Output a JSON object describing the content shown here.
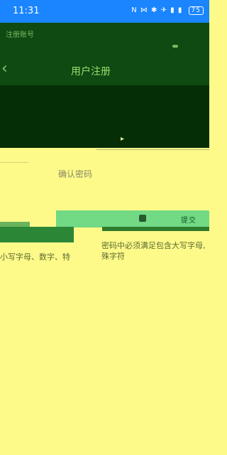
{
  "status": {
    "time": "11:31",
    "icons": "N ⋈ ✱ ✈ ▮ ▮",
    "battery": "75"
  },
  "header": {
    "title": "用户注册",
    "back_label": "‹",
    "sub": "注册账号"
  },
  "form": {
    "confirm_label": "确认密码",
    "green_button_label": "提交"
  },
  "hints": {
    "right_line1": "密码中必须满足包含大写字母,",
    "right_line2": "殊字符",
    "left_line": "小写字母、数字、特"
  }
}
